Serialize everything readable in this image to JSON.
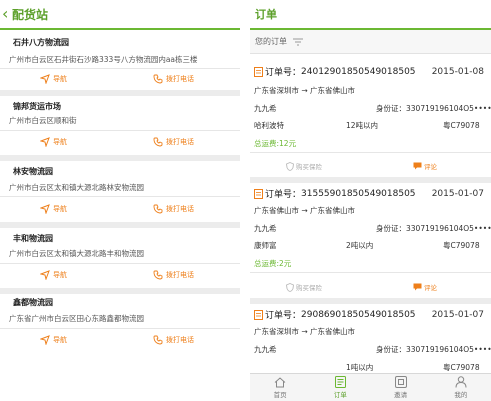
{
  "left": {
    "title": "配货站",
    "navigate_label": "导航",
    "call_label": "拨打电话",
    "stations": [
      {
        "name": "石井八方物流园",
        "address": "广州市白云区石井街石沙路333号八方物流园内aa栋三楼"
      },
      {
        "name": "锦邦货运市场",
        "address": "广州市白云区顺和街"
      },
      {
        "name": "林安物流园",
        "address": "广州市白云区太和镇大源北路林安物流园"
      },
      {
        "name": "丰和物流园",
        "address": "广州市白云区太和镇大源北路丰和物流园"
      },
      {
        "name": "鑫都物流园",
        "address": "广东省广州市白云区田心东路鑫都物流园"
      }
    ]
  },
  "right": {
    "title": "订单",
    "subtitle": "您的订单",
    "order_no_prefix": "订单号：",
    "id_prefix": "身份证：",
    "insurance_label": "购买保险",
    "comment_label": "评论",
    "orders": [
      {
        "order_no": "24012901850549018505",
        "date": "2015-01-08",
        "route": "广东省深圳市 → 广东省佛山市",
        "driver": "九九希",
        "id_card": "330719196104O5••••",
        "cargo": "哈利波特",
        "volume": "12吨以内",
        "plate": "粤C79078",
        "fee": "总运费:12元"
      },
      {
        "order_no": "31555901850549018505",
        "date": "2015-01-07",
        "route": "广东省佛山市 → 广东省佛山市",
        "driver": "九九希",
        "id_card": "330719196104O5••••",
        "cargo": "康师富",
        "volume": "2吨以内",
        "plate": "粤C79078",
        "fee": "总运费:2元"
      },
      {
        "order_no": "29086901850549018505",
        "date": "2015-01-07",
        "route": "广东省深圳市 → 广东省佛山市",
        "driver": "九九希",
        "id_card": "330719196104O5••••",
        "cargo": "",
        "volume": "1吨以内",
        "plate": "粤C79078",
        "fee": ""
      }
    ],
    "tabs": [
      {
        "label": "首页"
      },
      {
        "label": "订单"
      },
      {
        "label": "邀请"
      },
      {
        "label": "我的"
      }
    ],
    "colors": {
      "accent": "#6bb832",
      "action_orange": "#ee7f1a",
      "muted": "#aaaaaa"
    }
  }
}
